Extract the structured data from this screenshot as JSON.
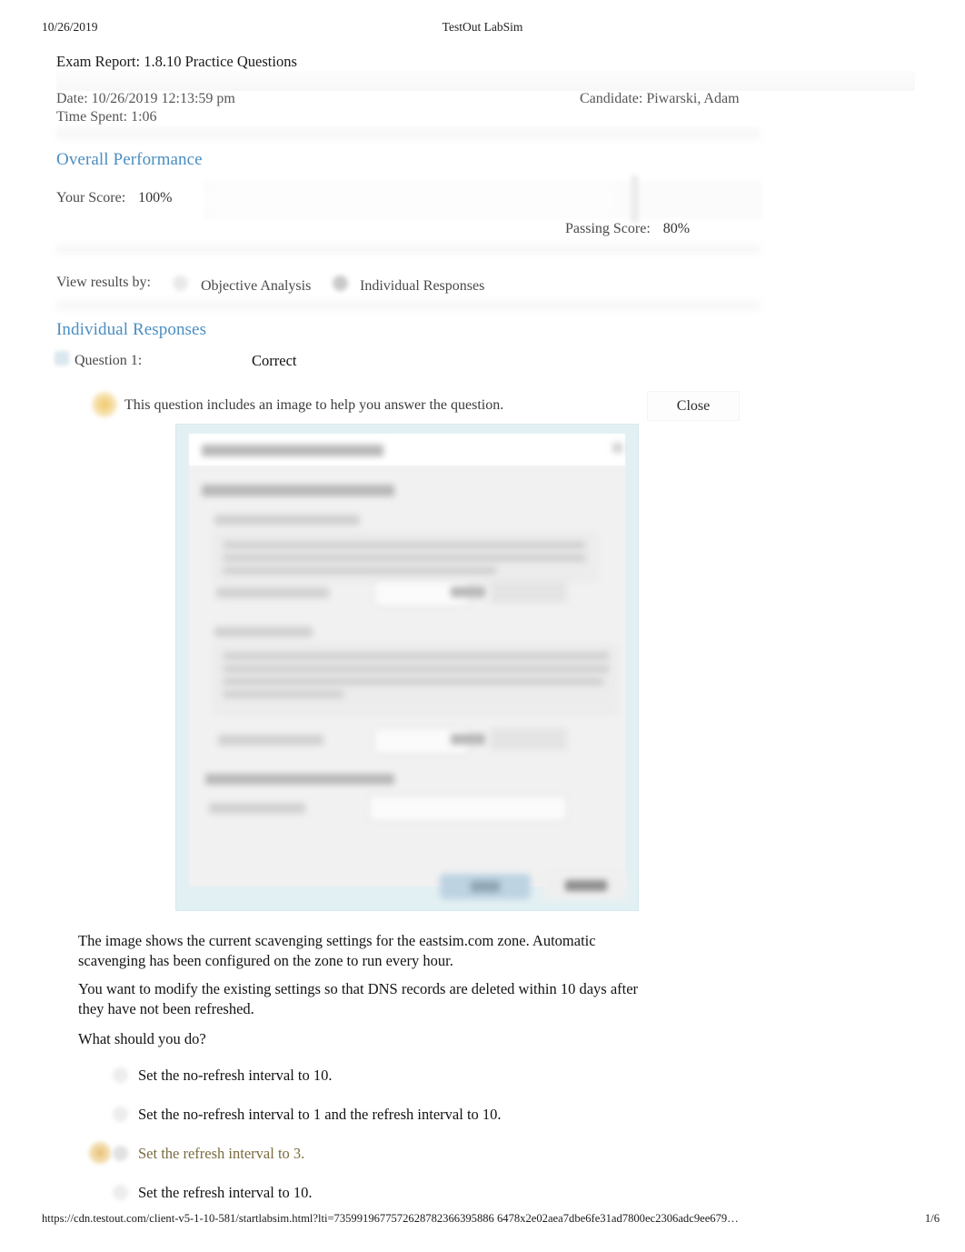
{
  "print": {
    "header_date": "10/26/2019",
    "header_title": "TestOut LabSim",
    "footer_url": "https://cdn.testout.com/client-v5-1-10-581/startlabsim.html?lti=7359919677572628782366395886 6478x2e02aea7dbe6fe31ad7800ec2306adc9ee679…",
    "footer_page": "1/6"
  },
  "report": {
    "exam_title": "Exam Report: 1.8.10 Practice Questions",
    "date_line": "Date: 10/26/2019 12:13:59 pm",
    "time_spent_line": "Time Spent: 1:06",
    "candidate_line": "Candidate: Piwarski, Adam"
  },
  "overall": {
    "heading": "Overall Performance",
    "your_score_label": "Your Score:",
    "your_score_value": "100%",
    "passing_score_label": "Passing Score:",
    "passing_score_value": "80%",
    "accent_color": "#4a8ec2"
  },
  "view_results": {
    "label": "View results by:",
    "options": [
      {
        "label": "Objective Analysis",
        "selected": false
      },
      {
        "label": "Individual Responses",
        "selected": true
      }
    ]
  },
  "individual": {
    "heading": "Individual Responses",
    "question_label": "Question 1:",
    "result": "Correct",
    "image_note": "This question includes an image to help you answer the question.",
    "close_label": "Close",
    "paragraphs": [
      "The image shows the current scavenging settings for the eastsim.com zone. Automatic scavenging has been configured on the zone to run every hour.",
      "You want to modify the existing settings so that DNS records are deleted within 10 days after they have not been refreshed.",
      "What should you do?"
    ],
    "answers": [
      {
        "text": "Set the no-refresh interval to 10.",
        "chosen": false,
        "correct": false
      },
      {
        "text": "Set the no-refresh interval to 1 and the refresh interval to 10.",
        "chosen": false,
        "correct": false
      },
      {
        "text": "Set the refresh interval to 3.",
        "chosen": true,
        "correct": true,
        "color": "#7a6b3e"
      },
      {
        "text": "Set the refresh interval to 10.",
        "chosen": false,
        "correct": false
      }
    ]
  },
  "question_image": {
    "description": "Blurred screenshot of a DNS zone aging/scavenging properties dialog",
    "border_color": "#d6e9ee",
    "background_color": "#e3f0f3"
  }
}
